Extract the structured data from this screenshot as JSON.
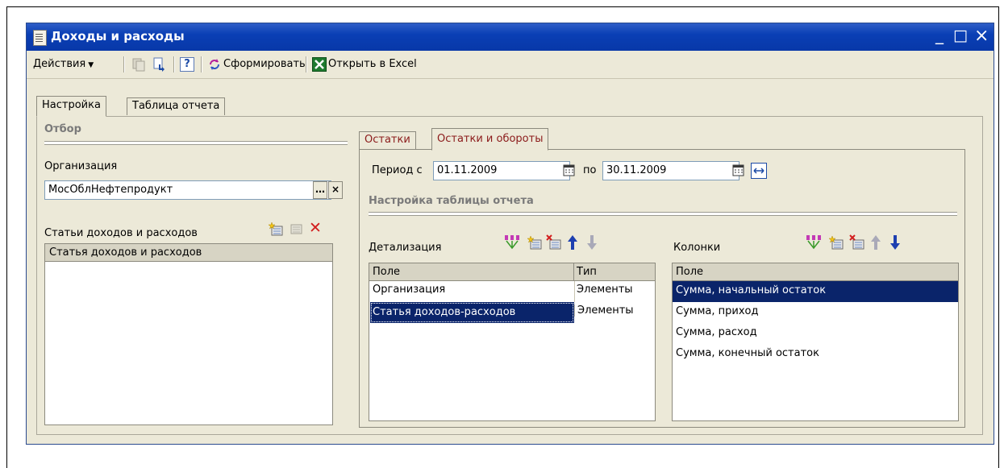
{
  "window": {
    "title": "Доходы и расходы",
    "accent": "#0a246a",
    "controls": [
      "_",
      "□",
      "×"
    ]
  },
  "toolbar": {
    "actions_label": "Действия",
    "generate_label": "Сформировать",
    "excel_label": "Открыть в Excel",
    "help_label": "?"
  },
  "tabs": {
    "settings": "Настройка",
    "report_table": "Таблица отчета"
  },
  "filter": {
    "header": "Отбор",
    "org_label": "Организация",
    "org_value": "МосОблНефтепродукт",
    "articles_label": "Статьи доходов и расходов",
    "articles_column": "Статья доходов и расходов"
  },
  "inner_tabs": {
    "balances": "Остатки",
    "balances_turnover": "Остатки и обороты"
  },
  "period": {
    "label_from": "Период с",
    "from": "01.11.2009",
    "label_to": "по",
    "to": "30.11.2009"
  },
  "table_settings": {
    "header": "Настройка таблицы отчета",
    "detail": {
      "label": "Детализация",
      "columns": [
        "Поле",
        "Тип"
      ],
      "rows": [
        {
          "field": "Организация",
          "type": "Элементы"
        },
        {
          "field": "Статья доходов-расходов",
          "type": "Элементы"
        }
      ],
      "selected_index": 1
    },
    "columns": {
      "label": "Колонки",
      "column": "Поле",
      "rows": [
        "Сумма, начальный остаток",
        "Сумма, приход",
        "Сумма, расход",
        "Сумма, конечный остаток"
      ],
      "selected_index": 0
    }
  }
}
